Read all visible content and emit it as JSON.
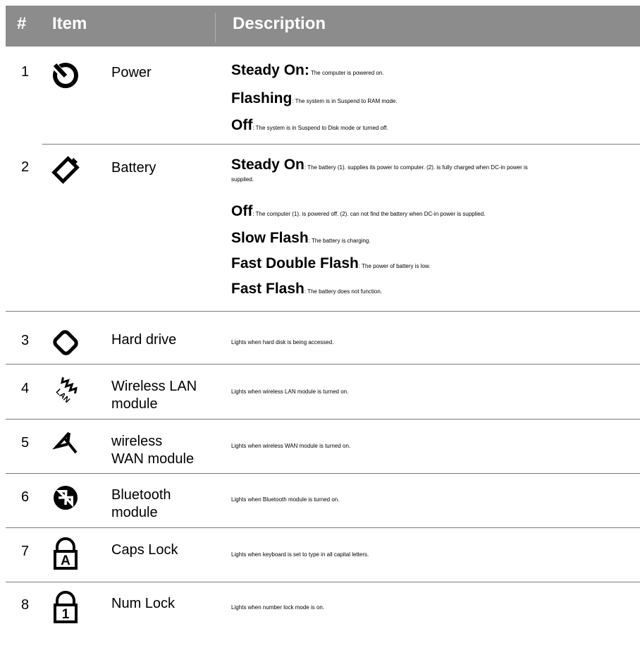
{
  "header": {
    "number": "#",
    "item": "Item",
    "description": "Description"
  },
  "rows": [
    {
      "number": "1",
      "icon": "power-icon",
      "name": "Power",
      "lines": [
        {
          "term": "Steady On:",
          "text": " The computer is powered on."
        },
        {
          "term": "Flashing",
          "text": ": The system is in Suspend to RAM mode."
        },
        {
          "term": "Off",
          "text": ": The system is in Suspend to Disk mode or turned off."
        }
      ]
    },
    {
      "number": "2",
      "icon": "battery-icon",
      "name": "Battery",
      "lines": [
        {
          "term": "Steady On",
          "text": ": The battery (1). supplies its power to computer. (2). is fully charged when DC-in power is",
          "cont": "supplied."
        },
        {
          "term": "Off",
          "text": ": The computer (1). is powered off. (2). can not find the battery when DC-in power is supplied."
        },
        {
          "term": "Slow Flash",
          "text": ": The battery is charging."
        },
        {
          "term": "Fast Double Flash",
          "text": ": The power of battery is low."
        },
        {
          "term": "Fast Flash",
          "text": ": The battery does not function."
        }
      ]
    },
    {
      "number": "3",
      "icon": "hard-drive-icon",
      "name": "Hard drive",
      "text": "Lights when hard disk is being accessed."
    },
    {
      "number": "4",
      "icon": "wireless-lan-icon",
      "name_line1": "Wireless LAN",
      "name_line2": "module",
      "text": "Lights when wireless LAN module is turned on."
    },
    {
      "number": "5",
      "icon": "wireless-wan-icon",
      "name_line1": "wireless",
      "name_line2": "WAN module",
      "text": "Lights when wireless WAN module is turned on."
    },
    {
      "number": "6",
      "icon": "bluetooth-icon",
      "name_line1": "Bluetooth",
      "name_line2": "module",
      "text": "Lights when Bluetooth module is turned on."
    },
    {
      "number": "7",
      "icon": "caps-lock-icon",
      "icon_letter": "A",
      "name": "Caps Lock",
      "text": "Lights when keyboard is set to type in all capital letters."
    },
    {
      "number": "8",
      "icon": "num-lock-icon",
      "icon_letter": "1",
      "name": "Num Lock",
      "text": "Lights when number lock mode is on."
    }
  ]
}
